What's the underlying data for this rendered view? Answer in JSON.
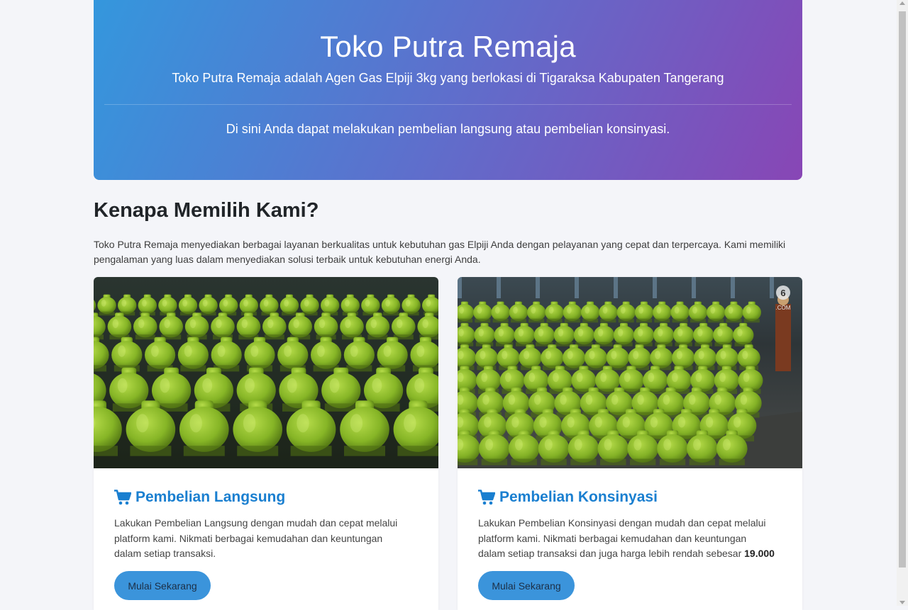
{
  "hero": {
    "title": "Toko Putra Remaja",
    "subtitle": "Toko Putra Remaja adalah Agen Gas Elpiji 3kg yang berlokasi di Tigaraksa Kabupaten Tangerang",
    "lead": "Di sini Anda dapat melakukan pembelian langsung atau pembelian konsinyasi.",
    "gradient_start": "#3497dd",
    "gradient_end": "#8846b5"
  },
  "why": {
    "title": "Kenapa Memilih Kami?",
    "text": "Toko Putra Remaja menyediakan berbagai layanan berkualitas untuk kebutuhan gas Elpiji Anda dengan pelayanan yang cepat dan terpercaya. Kami memiliki pengalaman yang luas dalam menyediakan solusi terbaik untuk kebutuhan energi Anda."
  },
  "cards": [
    {
      "icon": "shopping-cart-icon",
      "title": "Pembelian Langsung",
      "text": "Lakukan Pembelian Langsung dengan mudah dan cepat melalui platform kami. Nikmati berbagai kemudahan dan keuntungan dalam setiap transaksi.",
      "button": "Mulai Sekarang"
    },
    {
      "icon": "shopping-cart-icon",
      "title": "Pembelian Konsinyasi",
      "text": "Lakukan Pembelian Konsinyasi dengan mudah dan cepat melalui platform kami. Nikmati berbagai kemudahan dan keuntungan dalam setiap transaksi dan juga harga lebih rendah sebesar ",
      "price": "19.000",
      "button": "Mulai Sekarang",
      "watermark": "6 .COM"
    }
  ],
  "colors": {
    "accent": "#1a7fd0",
    "button": "#3b94db",
    "background": "#f4f5f9",
    "cylinder": "#8cbf2a"
  }
}
